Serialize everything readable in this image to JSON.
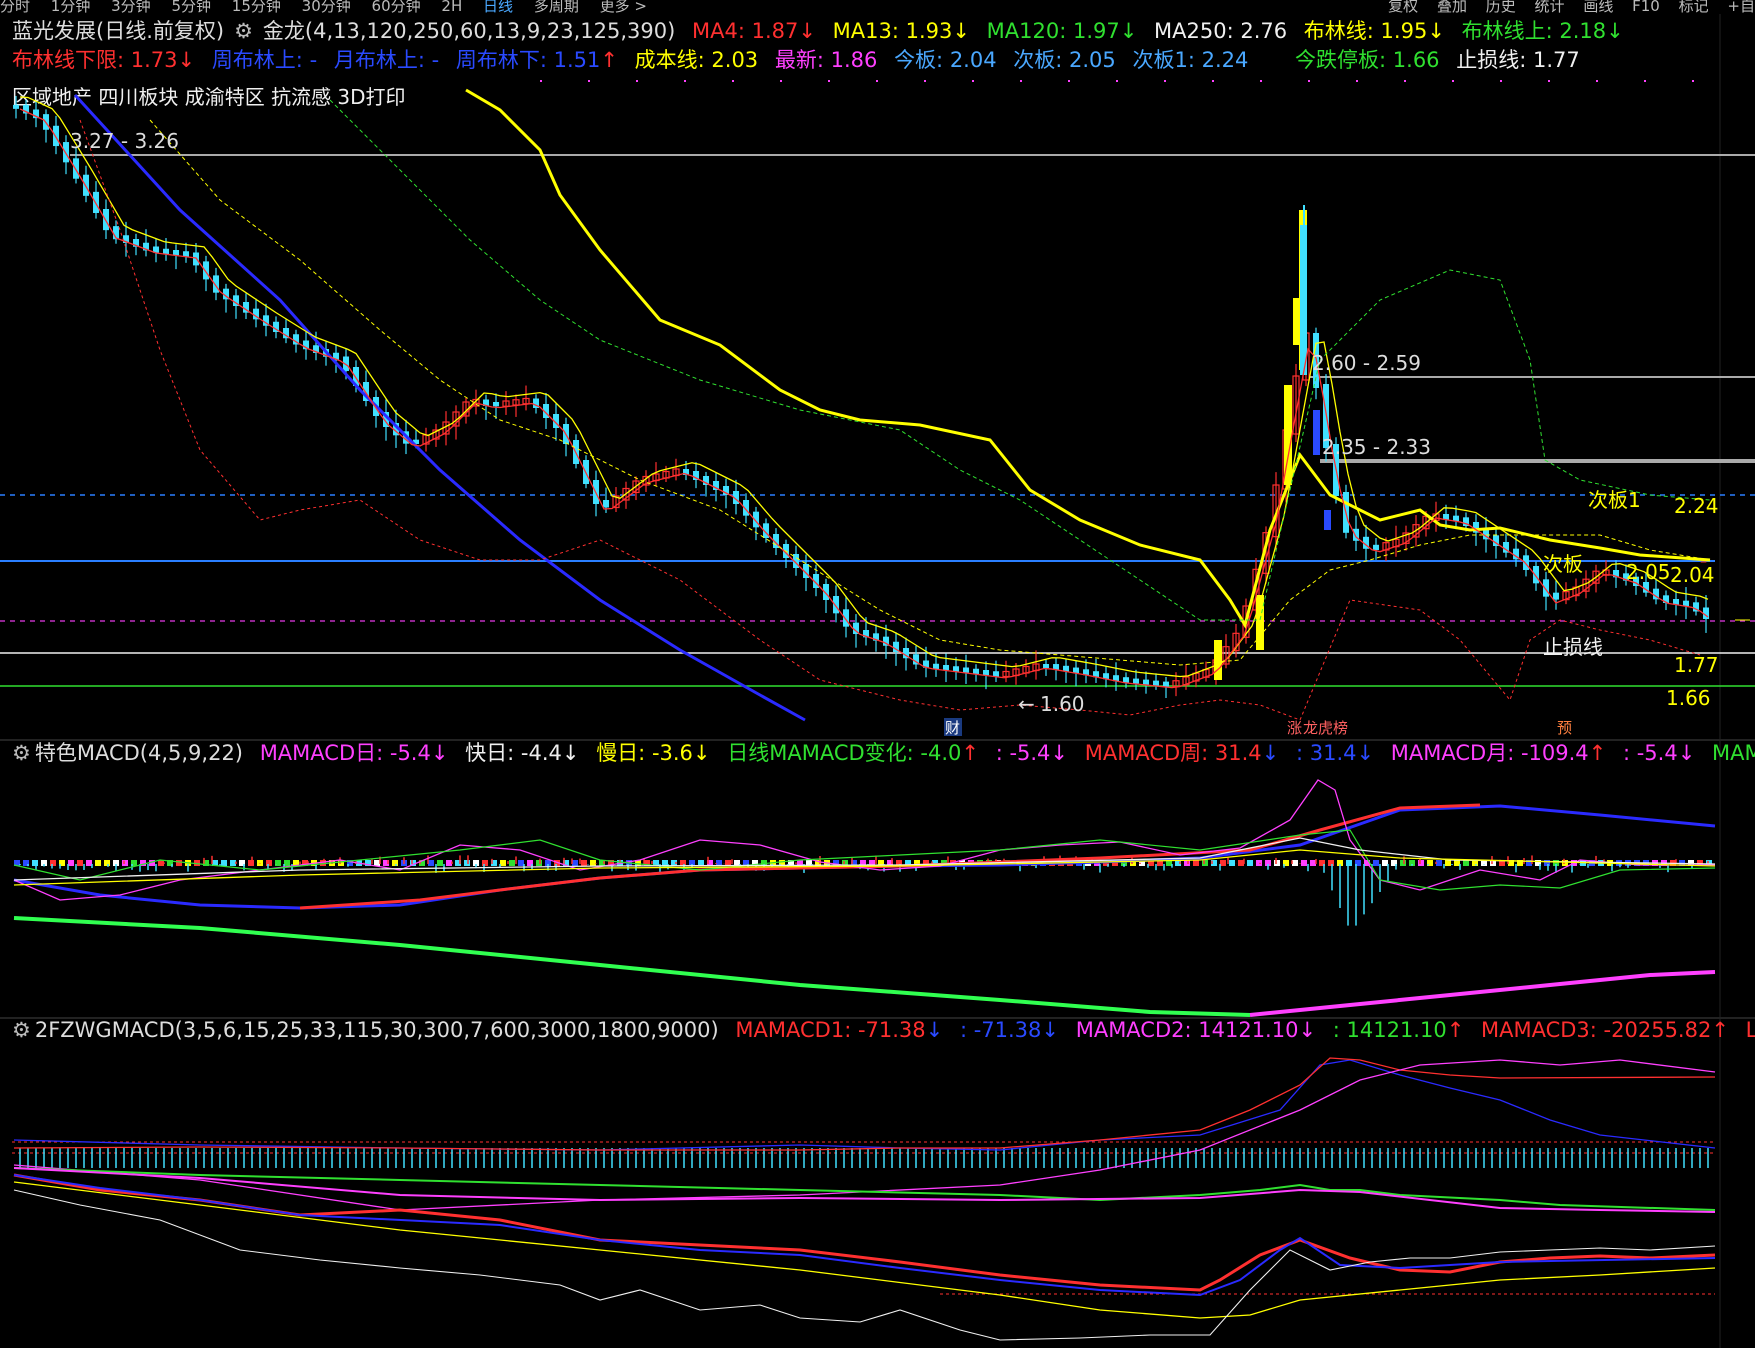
{
  "toolbar": {
    "periods": [
      "分时",
      "1分钟",
      "3分钟",
      "5分钟",
      "15分钟",
      "30分钟",
      "60分钟",
      "2H",
      "日线",
      "多周期",
      "更多 >"
    ],
    "active": "日线",
    "right_tools": [
      "复权",
      "叠加",
      "历史",
      "统计",
      "画线",
      "F10",
      "标记",
      "+自"
    ]
  },
  "main_pane": {
    "title": "蓝光发展(日线.前复权)",
    "indicator": "金龙(4,13,120,250,60,13,9,23,125,390)",
    "ma4": "MA4: 1.87",
    "ma13": "MA13: 1.93",
    "ma120": "MA120: 1.97",
    "ma250": "MA250: 2.76",
    "boll": "布林线: 1.95",
    "boll_up": "布林线上: 2.18",
    "boll_low": "布林线下限: 1.73",
    "week_boll_up": "周布林上: -",
    "month_boll_up": "月布林上: -",
    "week_boll_low": "周布林下: 1.51",
    "cost": "成本线: 2.03",
    "latest": "最新: 1.86",
    "today_board": "今板: 2.04",
    "next_board": "次板: 2.05",
    "next_board1": "次板1: 2.24",
    "limit_down": "今跌停板: 1.66",
    "stop_loss": "止损线: 1.77",
    "concepts": "区域地产  四川板块  成渝特区  抗流感  3D打印",
    "annotations": {
      "high1": "3.27 - 3.26",
      "level1": "2.60 - 2.59",
      "level2": "2.35 - 2.33",
      "next_board1_label": "次板1",
      "next_board1_val": "2.24",
      "next_board_label": "次板",
      "next_board_val": "2.05",
      "today_val": "2.04",
      "stop_label": "止损线",
      "stop_val": "1.77",
      "limit_val": "1.66",
      "low": "1.60",
      "marker_cai": "财",
      "marker_zt": "涨",
      "marker_lhb": "龙虎榜",
      "marker_yu": "预"
    }
  },
  "macd_pane": {
    "title": "特色MACD(4,5,9,22)",
    "v1": "MAMACD日: -5.4",
    "v2": "快日: -4.4",
    "v3": "慢日: -3.6",
    "v4": "日线MAMACD变化: -4.0",
    "v5": ": -5.4",
    "v6": "MAMACD周: 31.4",
    "v7": ": 31.4",
    "v8": "MAMACD月: -109.4",
    "v9": ": -5.4",
    "v10": "MAMA"
  },
  "macd2_pane": {
    "title": "2FZWGMACD(3,5,6,15,25,33,115,30,300,7,600,3000,1800,9000)",
    "v1": "MAMACD1: -71.38",
    "v2": ": -71.38",
    "v3": "MAMACD2: 14121.10",
    "v4": ": 14121.10",
    "v5": "MAMACD3: -20255.82",
    "v6": "LL"
  },
  "colors": {
    "red": "#ff3030",
    "yellow": "#ffff00",
    "green": "#30e030",
    "blue": "#2a2aff",
    "cyan": "#40e0ff",
    "magenta": "#ff40ff",
    "white": "#f0f0f0",
    "gray": "#aaaaaa"
  }
}
